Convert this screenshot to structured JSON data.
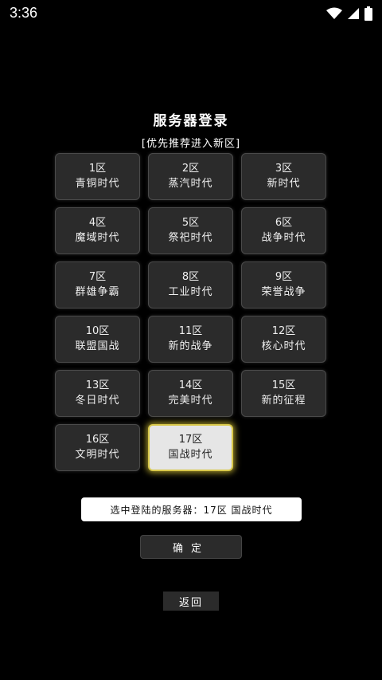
{
  "status_bar": {
    "time": "3:36",
    "icons": [
      "wifi-icon",
      "cell-signal-icon",
      "battery-icon"
    ]
  },
  "header": {
    "title": "服务器登录",
    "subtitle": "[优先推荐进入新区]"
  },
  "servers": [
    {
      "zone": "1区",
      "name": "青铜时代",
      "selected": false
    },
    {
      "zone": "2区",
      "name": "蒸汽时代",
      "selected": false
    },
    {
      "zone": "3区",
      "name": "新时代",
      "selected": false
    },
    {
      "zone": "4区",
      "name": "魔域时代",
      "selected": false
    },
    {
      "zone": "5区",
      "name": "祭祀时代",
      "selected": false
    },
    {
      "zone": "6区",
      "name": "战争时代",
      "selected": false
    },
    {
      "zone": "7区",
      "name": "群雄争霸",
      "selected": false
    },
    {
      "zone": "8区",
      "name": "工业时代",
      "selected": false
    },
    {
      "zone": "9区",
      "name": "荣誉战争",
      "selected": false
    },
    {
      "zone": "10区",
      "name": "联盟国战",
      "selected": false
    },
    {
      "zone": "11区",
      "name": "新的战争",
      "selected": false
    },
    {
      "zone": "12区",
      "name": "核心时代",
      "selected": false
    },
    {
      "zone": "13区",
      "name": "冬日时代",
      "selected": false
    },
    {
      "zone": "14区",
      "name": "完美时代",
      "selected": false
    },
    {
      "zone": "15区",
      "name": "新的征程",
      "selected": false
    },
    {
      "zone": "16区",
      "name": "文明时代",
      "selected": false
    },
    {
      "zone": "17区",
      "name": "国战时代",
      "selected": true
    }
  ],
  "selection": {
    "text": "选中登陆的服务器：17区 国战时代"
  },
  "actions": {
    "confirm_label": "确定",
    "back_label": "返回"
  },
  "colors": {
    "background": "#000000",
    "button": "#2b2b2b",
    "selected_button": "#e6e6e6",
    "selected_glow": "#d8c84a"
  }
}
